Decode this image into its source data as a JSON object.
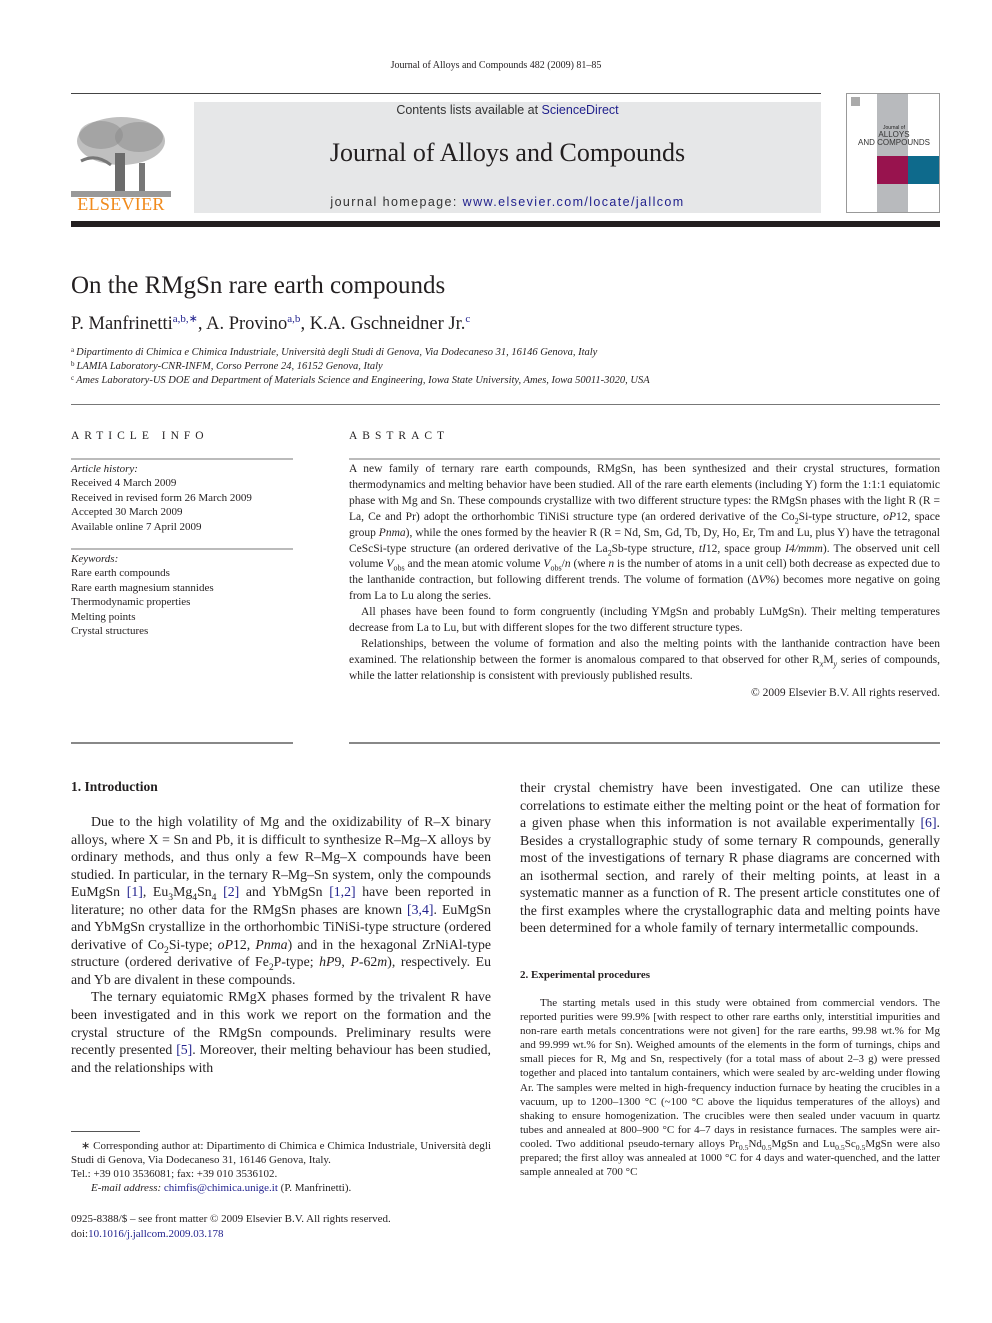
{
  "running_head": "Journal of Alloys and Compounds 482 (2009) 81–85",
  "masthead": {
    "publisher_logo_text": "ELSEVIER",
    "contents_prefix": "Contents lists available at ",
    "contents_link": "ScienceDirect",
    "journal_name": "Journal of Alloys and Compounds",
    "homepage_prefix": "journal homepage: ",
    "homepage_link": "www.elsevier.com/locate/jallcom",
    "cover_title_small": "Journal of",
    "cover_title_line1": "ALLOYS",
    "cover_title_line2": "AND COMPOUNDS",
    "colors": {
      "cover_magenta": "#98134e",
      "cover_teal": "#0e6a8c",
      "cover_grey": "#b8babd",
      "elsevier_orange": "#f08a1c",
      "link_blue": "#1f1f8c",
      "masthead_bg": "#e6e7e8"
    }
  },
  "article": {
    "title": "On the RMgSn rare earth compounds",
    "authors": [
      {
        "name": "P. Manfrinetti",
        "marks": "a,b,∗",
        "sep": ", "
      },
      {
        "name": "A. Provino",
        "marks": "a,b",
        "sep": ", "
      },
      {
        "name": "K.A. Gschneidner Jr.",
        "marks": "c",
        "sep": ""
      }
    ],
    "affiliations": [
      {
        "mark": "a",
        "text": "Dipartimento di Chimica e Chimica Industriale, Università degli Studi di Genova, Via Dodecaneso 31, 16146 Genova, Italy"
      },
      {
        "mark": "b",
        "text": "LAMIA Laboratory-CNR-INFM, Corso Perrone 24, 16152 Genova, Italy"
      },
      {
        "mark": "c",
        "text": "Ames Laboratory-US DOE and Department of Materials Science and Engineering, Iowa State University, Ames, Iowa 50011-3020, USA"
      }
    ]
  },
  "article_info": {
    "heading": "ARTICLE INFO",
    "history_label": "Article history:",
    "history": [
      "Received 4 March 2009",
      "Received in revised form 26 March 2009",
      "Accepted 30 March 2009",
      "Available online 7 April 2009"
    ],
    "keywords_label": "Keywords:",
    "keywords": [
      "Rare earth compounds",
      "Rare earth magnesium stannides",
      "Thermodynamic properties",
      "Melting points",
      "Crystal structures"
    ]
  },
  "abstract": {
    "heading": "ABSTRACT",
    "p1": {
      "a": "A new family of ternary rare earth compounds, RMgSn, has been synthesized and their crystal structures, formation thermodynamics and melting behavior have been studied. All of the rare earth elements (including Y) form the 1:1:1 equiatomic phase with Mg and Sn. These compounds crystallize with two different structure types: the RMgSn phases with the light R (R = La, Ce and Pr) adopt the orthorhombic TiNiSi structure type (an ordered derivative of the Co",
      "b": "2",
      "c": "Si-type structure, ",
      "d": "oP",
      "e": "12, space group ",
      "f": "Pnma",
      "g": "), while the ones formed by the heavier R (R = Nd, Sm, Gd, Tb, Dy, Ho, Er, Tm and Lu, plus Y) have the tetragonal CeScSi-type structure (an ordered derivative of the La",
      "h": "2",
      "i": "Sb-type structure, ",
      "j": "tI",
      "k": "12, space group ",
      "l": "I4/mmm",
      "m": "). The observed unit cell volume ",
      "n": "V",
      "o": "obs",
      "p": " and the mean atomic volume ",
      "q": "V",
      "r": "obs",
      "s": "/",
      "t": "n",
      "u": " (where ",
      "v": "n",
      "w": " is the number of atoms in a unit cell) both decrease as expected due to the lanthanide contraction, but following different trends. The volume of formation (Δ",
      "x": "V",
      "y": "%) becomes more negative on going from La to Lu along the series."
    },
    "p2": "All phases have been found to form congruently (including YMgSn and probably LuMgSn). Their melting temperatures decrease from La to Lu, but with different slopes for the two different structure types.",
    "p3": {
      "a": "Relationships, between the volume of formation and also the melting points with the lanthanide contraction have been examined. The relationship between the former is anomalous compared to that observed for other R",
      "b": "x",
      "c": "M",
      "d": "y",
      "e": " series of compounds, while the latter relationship is consistent with previously published results."
    },
    "copyright": "© 2009 Elsevier B.V. All rights reserved."
  },
  "introduction": {
    "heading": "1.  Introduction",
    "p1": {
      "a": "Due to the high volatility of Mg and the oxidizability of R–X binary alloys, where X = Sn and Pb, it is difficult to synthesize R–Mg–X alloys by ordinary methods, and thus only a few R–Mg–X compounds have been studied. In particular, in the ternary R–Mg–Sn system, only the compounds EuMgSn ",
      "ref1": "[1]",
      "b": ", Eu",
      "s1": "3",
      "c": "Mg",
      "s2": "4",
      "d": "Sn",
      "s3": "4",
      "e": " ",
      "ref2": "[2]",
      "f": " and YbMgSn ",
      "ref3": "[1,2]",
      "g": " have been reported in literature; no other data for the RMgSn phases are known ",
      "ref4": "[3,4]",
      "h": ". EuMgSn and YbMgSn crystallize in the orthorhombic TiNiSi-type structure (ordered derivative of Co",
      "s4": "2",
      "i": "Si-type; ",
      "it1": "oP",
      "j": "12, ",
      "it2": "Pnma",
      "k": ") and in the hexagonal ZrNiAl-type structure (ordered derivative of Fe",
      "s5": "2",
      "l": "P-type; ",
      "it3": "hP",
      "m": "9, ",
      "it4": "P",
      "n": "-62",
      "it5": "m",
      "o": "), respectively. Eu and Yb are divalent in these compounds."
    },
    "p2": {
      "a": "The ternary equiatomic RMgX phases formed by the trivalent R have been investigated and in this work we report on the formation and the crystal structure of the RMgSn compounds. Preliminary results were recently presented ",
      "ref": "[5]",
      "b": ". Moreover, their melting behaviour has been studied, and the relationships with"
    },
    "p3": {
      "a": "their crystal chemistry have been investigated. One can utilize these correlations to estimate either the melting point or the heat of formation for a given phase when this information is not available experimentally ",
      "ref": "[6]",
      "b": ". Besides a crystallographic study of some ternary R compounds, generally most of the investigations of ternary R phase diagrams are concerned with an isothermal section, and rarely of their melting points, at least in a systematic manner as a function of R. The present article constitutes one of the first examples where the crystallographic data and melting points have been determined for a whole family of ternary intermetallic compounds."
    }
  },
  "experimental": {
    "heading": "2.  Experimental procedures",
    "p1": {
      "a": "The starting metals used in this study were obtained from commercial vendors. The reported purities were 99.9% [with respect to other rare earths only, interstitial impurities and non-rare earth metals concentrations were not given] for the rare earths, 99.98 wt.% for Mg and 99.999 wt.% for Sn). Weighed amounts of the elements in the form of turnings, chips and small pieces for R, Mg and Sn, respectively (for a total mass of about 2–3 g) were pressed together and placed into tantalum containers, which were sealed by arc-welding under flowing Ar. The samples were melted in high-frequency induction furnace by heating the crucibles in a vacuum, up to 1200–1300 °C (~100 °C above the liquidus temperatures of the alloys) and shaking to ensure homogenization. The crucibles were then sealed under vacuum in quartz tubes and annealed at 800–900 °C for 4–7 days in resistance furnaces. The samples were air-cooled. Two additional pseudo-ternary alloys Pr",
      "s1": "0.5",
      "b": "Nd",
      "s2": "0.5",
      "c": "MgSn and Lu",
      "s3": "0.5",
      "d": "Sc",
      "s4": "0.5",
      "e": "MgSn were also prepared; the first alloy was annealed at 1000 °C for 4 days and water-quenched, and the latter sample annealed at 700 °C"
    }
  },
  "footnote": {
    "mark": "∗",
    "text": "Corresponding author at: Dipartimento di Chimica e Chimica Industriale, Università degli Studi di Genova, Via Dodecaneso 31, 16146 Genova, Italy.",
    "tel": "Tel.: +39 010 3536081; fax: +39 010 3536102.",
    "email_label": "E-mail address: ",
    "email": "chimfis@chimica.unige.it",
    "email_suffix": " (P. Manfrinetti)."
  },
  "footer": {
    "issn_line": "0925-8388/$ – see front matter © 2009 Elsevier B.V. All rights reserved.",
    "doi_prefix": "doi:",
    "doi": "10.1016/j.jallcom.2009.03.178"
  }
}
